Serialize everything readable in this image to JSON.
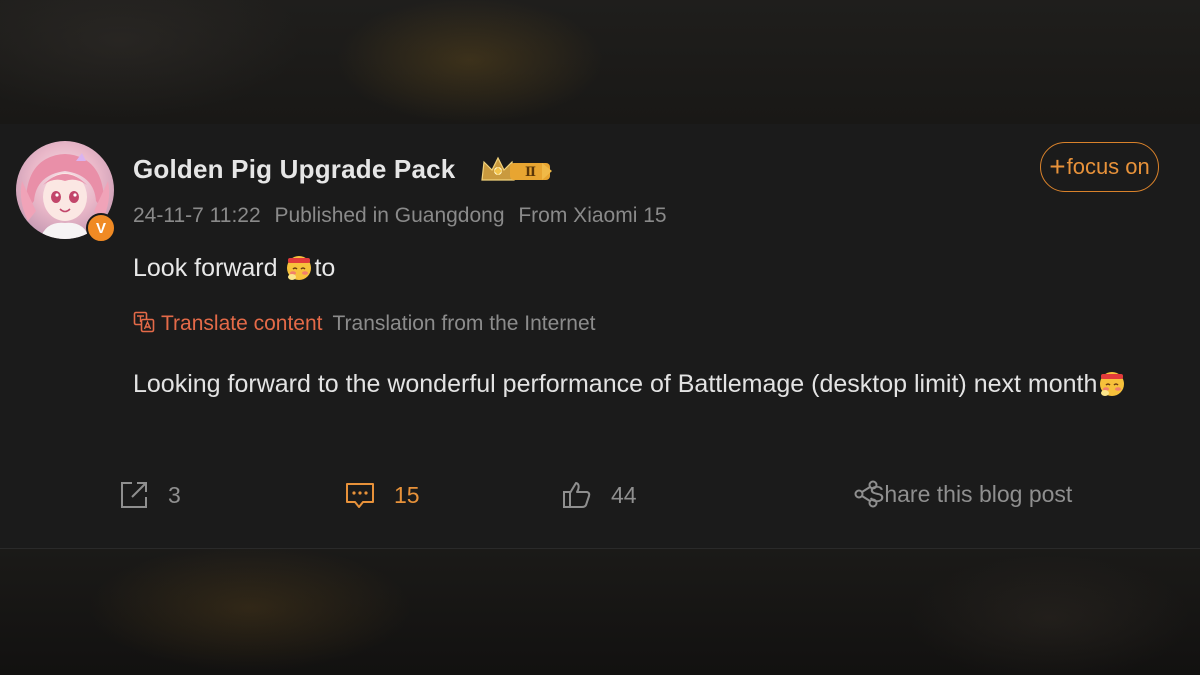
{
  "post": {
    "author": {
      "name": "Golden Pig Upgrade Pack",
      "verified_badge": "V",
      "level_badge": "Ⅱ"
    },
    "follow_label": "focus on",
    "meta": {
      "timestamp": "24-11-7 11:22",
      "location": "Published in Guangdong",
      "device": "From Xiaomi 15"
    },
    "original_text": {
      "before": "Look forward ",
      "after": "to"
    },
    "translation": {
      "link_label": "Translate content",
      "source_label": "Translation from the Internet",
      "text": "Looking forward to the wonderful performance of Battlemage (desktop limit) next month"
    },
    "actions": {
      "repost_count": "3",
      "comment_count": "15",
      "like_count": "44",
      "share_label": "Share this blog post"
    }
  },
  "colors": {
    "accent": "#e8923a",
    "translate_link": "#e46a48",
    "card_bg": "#1b1b1b",
    "text": "#e8e8e8",
    "muted": "#8a8a8a"
  },
  "icons": [
    "avatar-anime-girl",
    "verified-v-icon",
    "crown-level-icon",
    "plus-icon",
    "blushing-emoji",
    "translate-icon",
    "repost-icon",
    "comment-icon",
    "thumbs-up-icon",
    "share-nodes-icon"
  ]
}
